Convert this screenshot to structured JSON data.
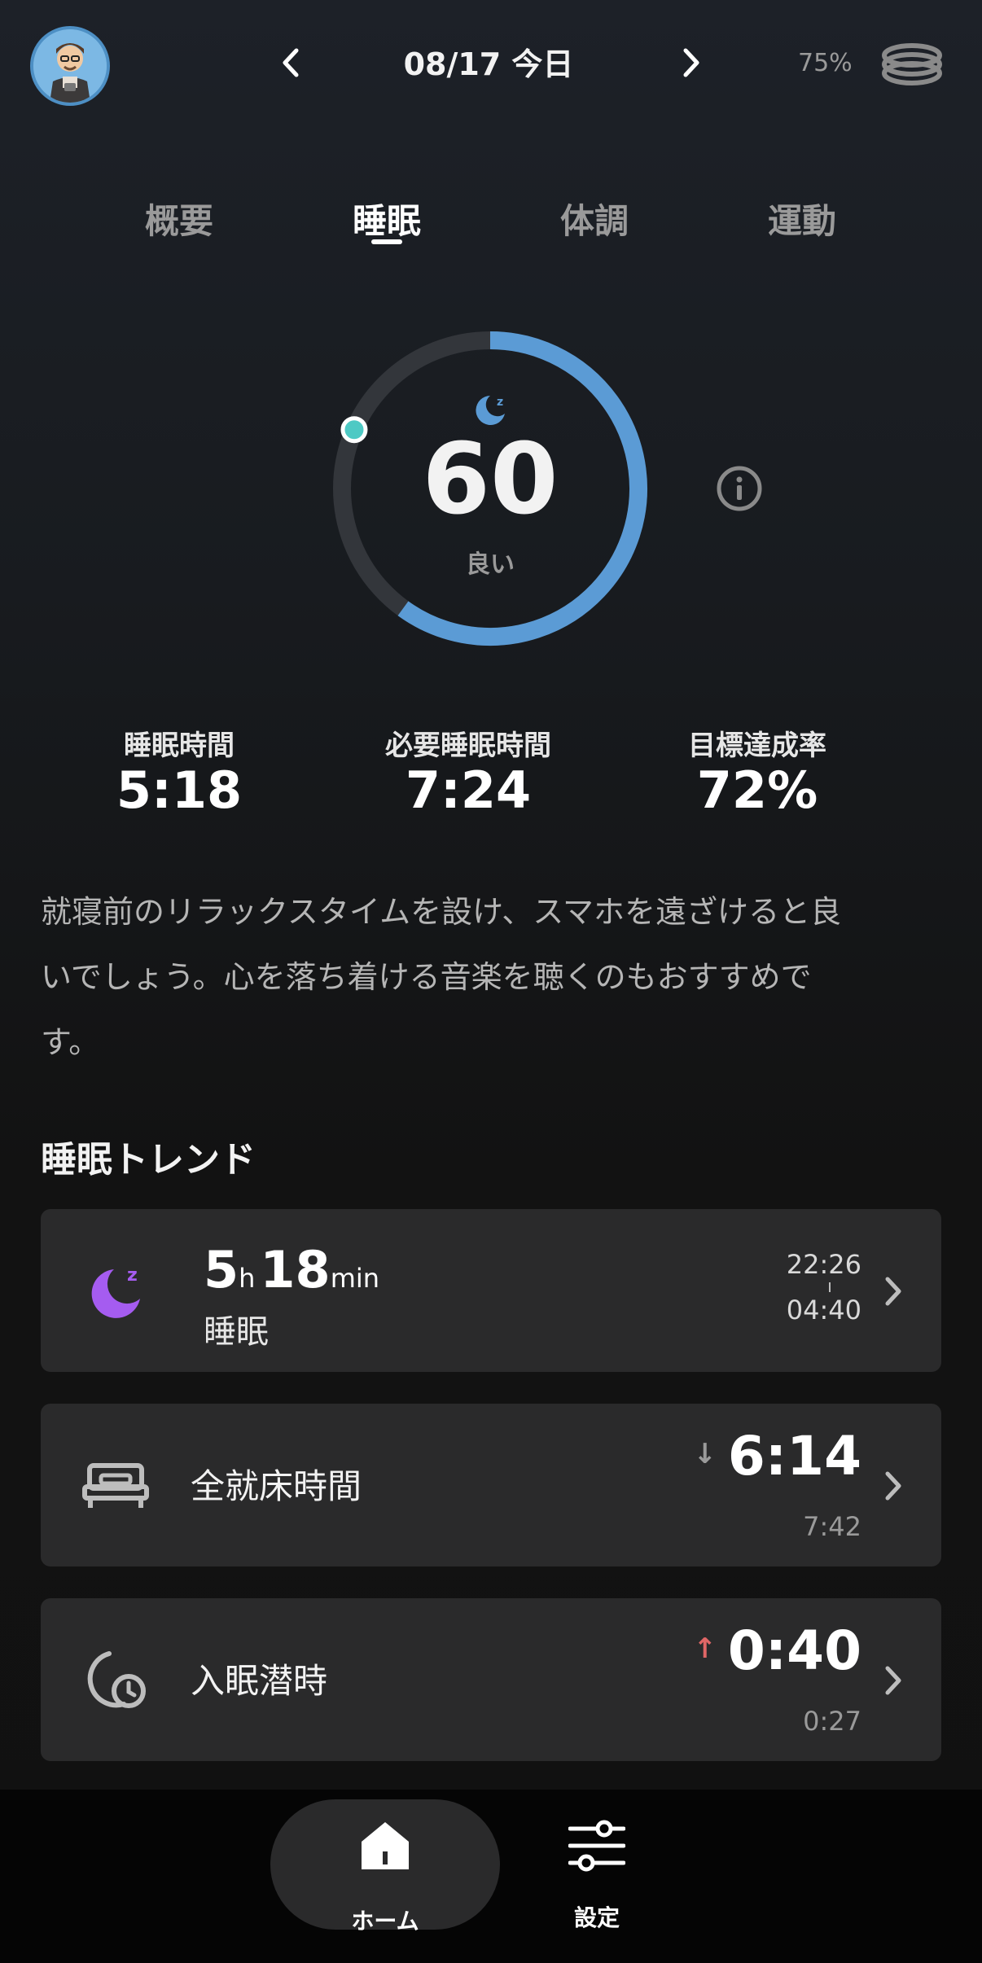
{
  "header": {
    "date_title": "08/17 今日",
    "battery_percent": "75%"
  },
  "tabs": [
    {
      "label": "概要",
      "active": false
    },
    {
      "label": "睡眠",
      "active": true
    },
    {
      "label": "体調",
      "active": false
    },
    {
      "label": "運動",
      "active": false
    }
  ],
  "score": {
    "value": "60",
    "label": "良い",
    "fill_fraction": 0.6,
    "accent_color": "#5b9bd5",
    "marker_color": "#4ec9c4"
  },
  "stats": [
    {
      "label": "睡眠時間",
      "value": "5:18"
    },
    {
      "label": "必要睡眠時間",
      "value": "7:24"
    },
    {
      "label": "目標達成率",
      "value": "72%"
    }
  ],
  "advice_line1": "就寝前のリラックスタイムを設け、スマホを遠ざけると良",
  "advice_line2": "いでしょう。心を落ち着ける音楽を聴くのもおすすめで",
  "advice_line3": "す。",
  "trend": {
    "title": "睡眠トレンド",
    "sleep_card": {
      "hours": "5",
      "hours_unit": "h",
      "minutes": "18",
      "minutes_unit": "min",
      "label": "睡眠",
      "start_time": "22:26",
      "end_time": "04:40",
      "icon": "moon-sleep-icon",
      "icon_color": "#a55cf0"
    },
    "bed_card": {
      "label": "全就床時間",
      "value": "6:14",
      "reference": "7:42",
      "trend": "down",
      "arrow_glyph": "↓",
      "arrow_color": "#9a9a9a",
      "icon": "bed-icon"
    },
    "latency_card": {
      "label": "入眠潜時",
      "value": "0:40",
      "reference": "0:27",
      "trend": "up",
      "arrow_glyph": "↑",
      "arrow_color": "#e06666",
      "icon": "moon-clock-icon"
    }
  },
  "bottom_nav": {
    "home_label": "ホーム",
    "settings_label": "設定"
  }
}
